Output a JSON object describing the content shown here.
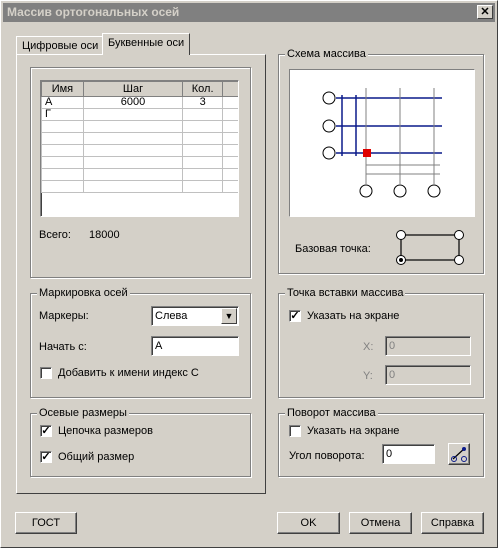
{
  "window": {
    "title": "Массив ортогональных осей",
    "close_glyph": "✕"
  },
  "tabs": [
    {
      "label": "Цифровые оси"
    },
    {
      "label": "Буквенные оси"
    }
  ],
  "grid": {
    "headers": [
      "Имя",
      "Шаг",
      "Кол."
    ],
    "rows": [
      [
        "А",
        "6000",
        "3"
      ],
      [
        "Г",
        "",
        ""
      ],
      [
        "",
        "",
        ""
      ],
      [
        "",
        "",
        ""
      ],
      [
        "",
        "",
        ""
      ],
      [
        "",
        "",
        ""
      ],
      [
        "",
        "",
        ""
      ],
      [
        "",
        "",
        ""
      ]
    ],
    "total_label": "Всего:",
    "total_value": "18000"
  },
  "marking": {
    "title": "Маркировка осей",
    "markers_label": "Маркеры:",
    "markers_value": "Слева",
    "start_label": "Начать с:",
    "start_value": "А",
    "add_index_label": "Добавить к имени индекс С",
    "add_index_checked": false
  },
  "dimensions": {
    "title": "Осевые размеры",
    "chain_label": "Цепочка размеров",
    "chain_checked": true,
    "total_label": "Общий размер",
    "total_checked": true
  },
  "scheme": {
    "title": "Схема массива",
    "base_point_label": "Базовая точка:"
  },
  "insert_point": {
    "title": "Точка вставки массива",
    "on_screen_label": "Указать на экране",
    "on_screen_checked": true,
    "x_label": "X:",
    "x_value": "0",
    "y_label": "Y:",
    "y_value": "0"
  },
  "rotation": {
    "title": "Поворот массива",
    "on_screen_label": "Указать на экране",
    "on_screen_checked": false,
    "angle_label": "Угол поворота:",
    "angle_value": "0"
  },
  "buttons": {
    "gost": "ГОСТ",
    "ok": "OK",
    "cancel": "Отмена",
    "help": "Справка"
  },
  "colors": {
    "axis_blue": "#0a1a8a",
    "base_red": "#e00000"
  }
}
